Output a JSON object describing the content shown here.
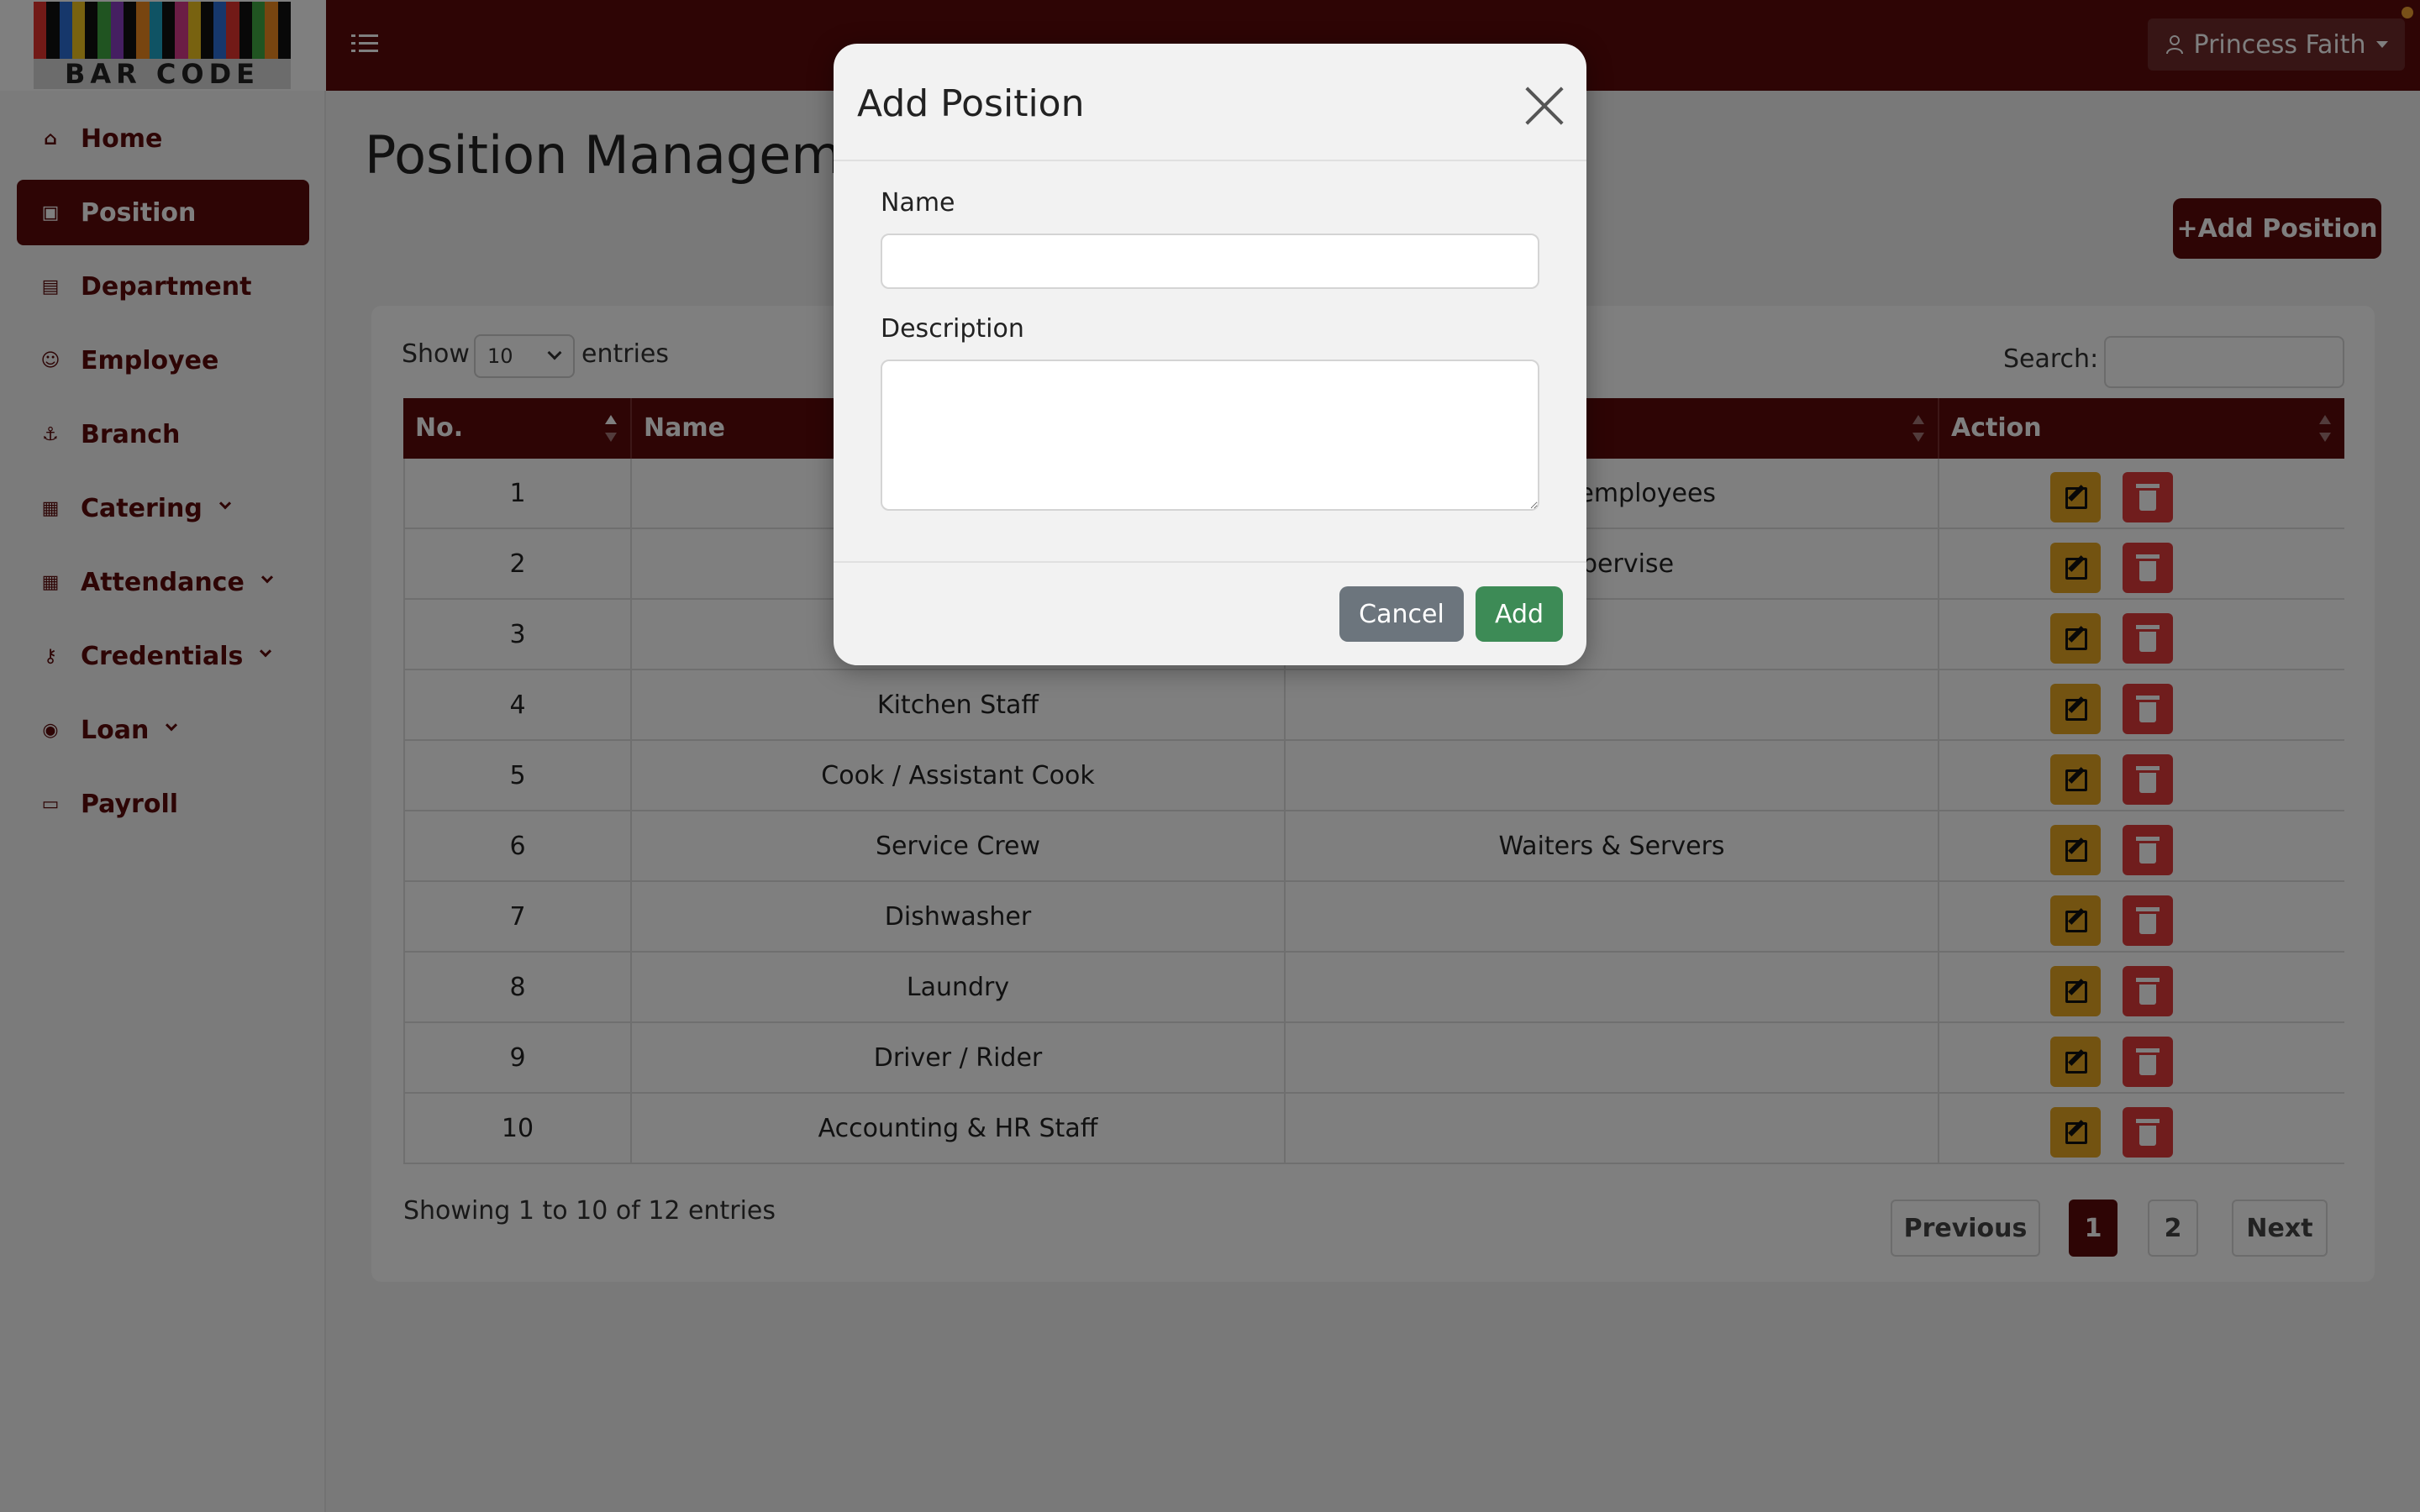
{
  "header": {
    "logo_text": "BAR CODE",
    "user_name": "Princess Faith",
    "menu_icon": "list-icon",
    "user_icon": "user-icon"
  },
  "colors": {
    "brand": "#5c0a0a",
    "edit": "#e6a722",
    "delete": "#e03b3b",
    "add": "#3d8b56",
    "cancel": "#6c757d"
  },
  "sidebar": {
    "items": [
      {
        "label": "Home",
        "icon": "home-icon",
        "active": false,
        "dropdown": false
      },
      {
        "label": "Position",
        "icon": "position-icon",
        "active": true,
        "dropdown": false
      },
      {
        "label": "Department",
        "icon": "building-icon",
        "active": false,
        "dropdown": false
      },
      {
        "label": "Employee",
        "icon": "user-icon",
        "active": false,
        "dropdown": false
      },
      {
        "label": "Branch",
        "icon": "branch-icon",
        "active": false,
        "dropdown": false
      },
      {
        "label": "Catering",
        "icon": "catering-icon",
        "active": false,
        "dropdown": true
      },
      {
        "label": "Attendance",
        "icon": "calendar-icon",
        "active": false,
        "dropdown": true
      },
      {
        "label": "Credentials",
        "icon": "key-icon",
        "active": false,
        "dropdown": true
      },
      {
        "label": "Loan",
        "icon": "money-icon",
        "active": false,
        "dropdown": true
      },
      {
        "label": "Payroll",
        "icon": "card-icon",
        "active": false,
        "dropdown": false
      }
    ]
  },
  "main": {
    "title": "Position Manageme",
    "add_button": "+Add Position",
    "show_label": "Show",
    "entries_value": "10",
    "entries_label": "entries",
    "search_label": "Search:",
    "columns": [
      "No.",
      "Name",
      "",
      "Action"
    ],
    "rows": [
      {
        "no": "1",
        "name": "",
        "description": "nage employees"
      },
      {
        "no": "2",
        "name": "",
        "description": "Supervise"
      },
      {
        "no": "3",
        "name": "",
        "description": ""
      },
      {
        "no": "4",
        "name": "Kitchen Staff",
        "description": ""
      },
      {
        "no": "5",
        "name": "Cook / Assistant Cook",
        "description": ""
      },
      {
        "no": "6",
        "name": "Service Crew",
        "description": "Waiters & Servers"
      },
      {
        "no": "7",
        "name": "Dishwasher",
        "description": ""
      },
      {
        "no": "8",
        "name": "Laundry",
        "description": ""
      },
      {
        "no": "9",
        "name": "Driver / Rider",
        "description": ""
      },
      {
        "no": "10",
        "name": "Accounting & HR Staff",
        "description": ""
      }
    ],
    "info": "Showing 1 to 10 of 12 entries",
    "pagination": {
      "previous": "Previous",
      "pages": [
        "1",
        "2"
      ],
      "current": "1",
      "next": "Next"
    }
  },
  "modal": {
    "title": "Add Position",
    "name_label": "Name",
    "name_value": "",
    "description_label": "Description",
    "description_value": "",
    "cancel_label": "Cancel",
    "add_label": "Add"
  }
}
